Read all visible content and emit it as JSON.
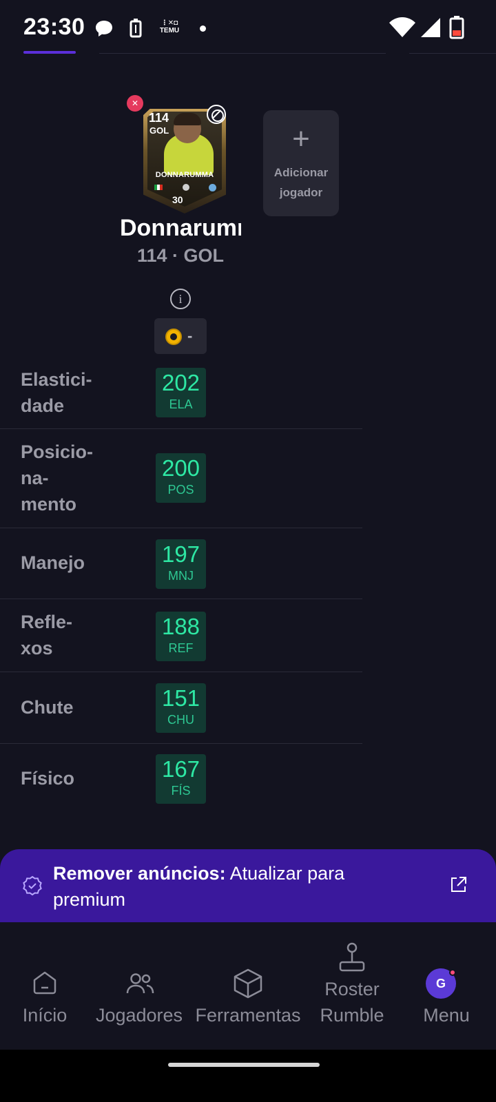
{
  "status_bar": {
    "time": "23:30",
    "temu_label": "TEMU",
    "icons": [
      "chat-bubble-icon",
      "battery-saver-icon",
      "temu-icon",
      "notification-dot-icon",
      "wifi-icon",
      "signal-icon",
      "battery-low-icon"
    ]
  },
  "player_card": {
    "rating": "114",
    "position": "GOL",
    "card_name": "DONNARUMMA",
    "chemistry": "30",
    "badges": [
      "remove-icon",
      "untradeable-icon"
    ]
  },
  "add_player": {
    "plus": "+",
    "label": "Adicionar jogador"
  },
  "player": {
    "name": "Donnarumma",
    "subtitle": "114 · GOL"
  },
  "chem_display": {
    "value": "-"
  },
  "stats": [
    {
      "label": "Elastici-\ndade",
      "value": "202",
      "abbr": "ELA"
    },
    {
      "label": "Posicio-\nna-\nmento",
      "value": "200",
      "abbr": "POS"
    },
    {
      "label": "Manejo",
      "value": "197",
      "abbr": "MNJ"
    },
    {
      "label": "Refle-\nxos",
      "value": "188",
      "abbr": "REF"
    },
    {
      "label": "Chute",
      "value": "151",
      "abbr": "CHU"
    },
    {
      "label": "Físico",
      "value": "167",
      "abbr": "FÍS"
    }
  ],
  "premium_banner": {
    "bold": "Remover anúncios:",
    "text": " Atualizar para premium",
    "icons": [
      "verified-badge-icon",
      "external-link-icon"
    ]
  },
  "bottom_nav": {
    "items": [
      {
        "label": "Início",
        "icon": "home-icon"
      },
      {
        "label": "Jogadores",
        "icon": "users-icon"
      },
      {
        "label": "Ferramentas",
        "icon": "box-icon"
      },
      {
        "label": "Roster\nRumble",
        "icon": "joystick-icon"
      },
      {
        "label": "Menu",
        "icon": "avatar"
      }
    ],
    "avatar_initial": "G"
  },
  "colors": {
    "background": "#13131f",
    "accent": "#3a189c",
    "stat_value": "#2ee8a4",
    "stat_chip": "#123a32",
    "remove": "#e53a5e"
  }
}
